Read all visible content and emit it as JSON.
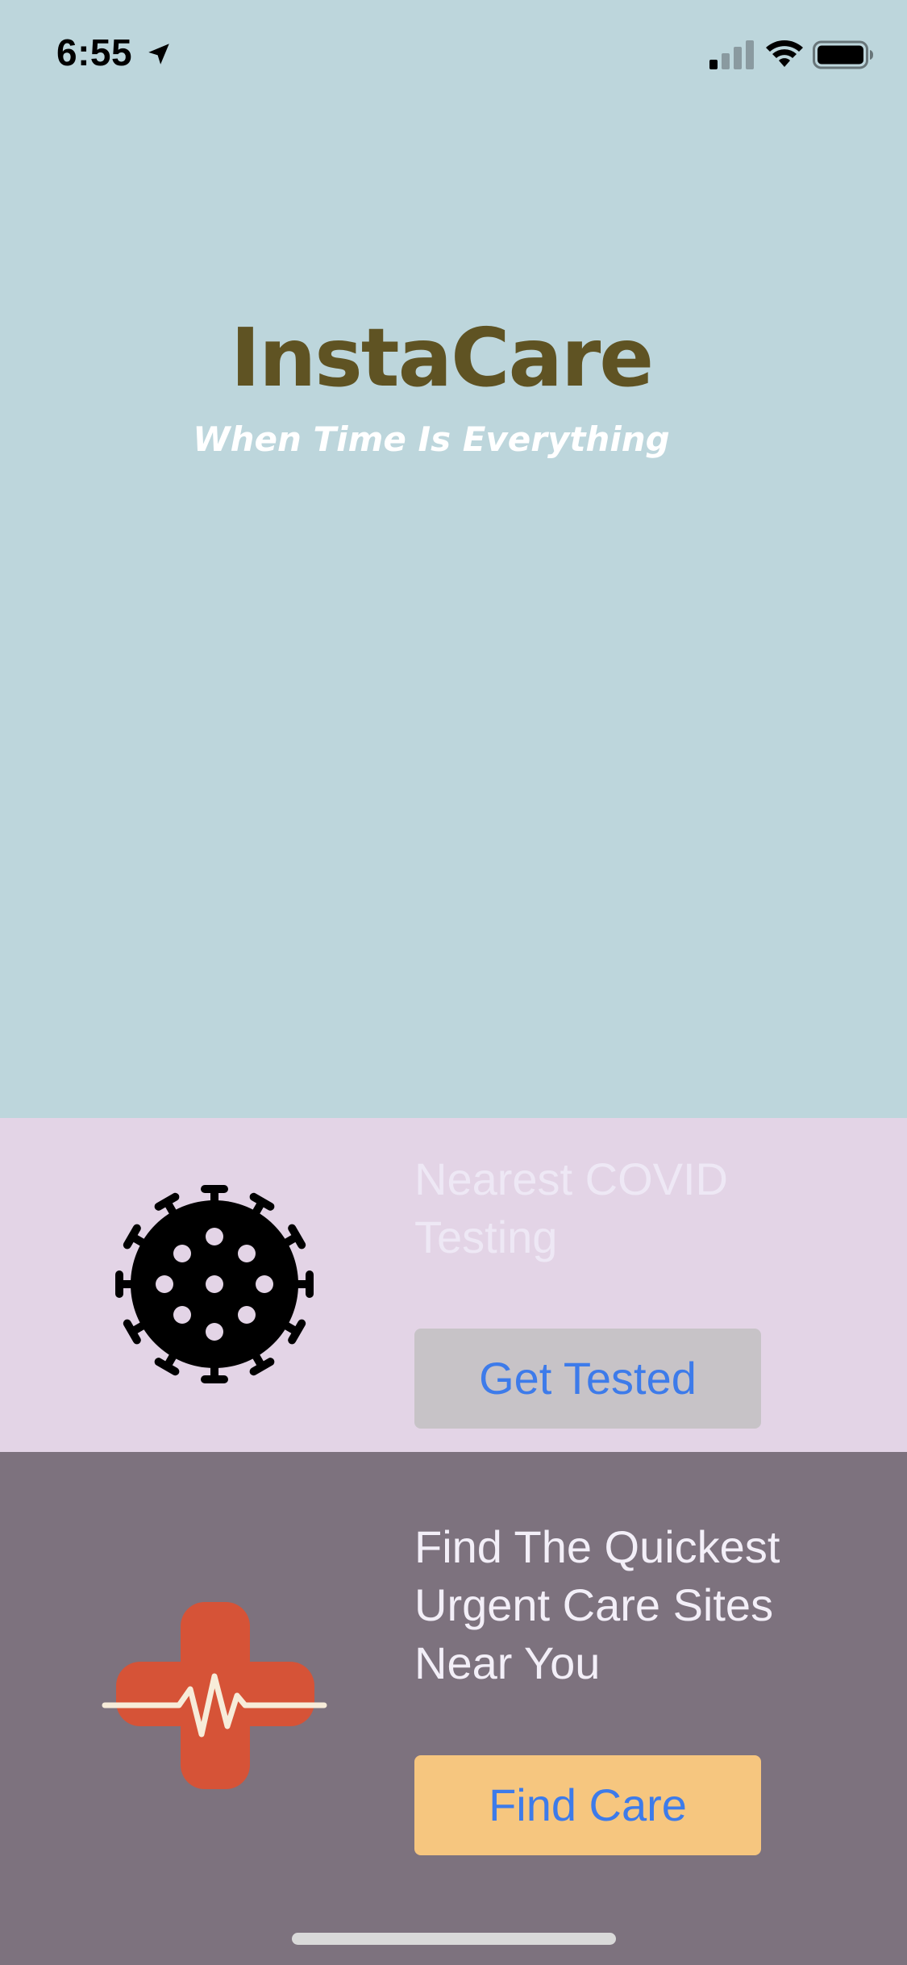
{
  "status_bar": {
    "time": "6:55"
  },
  "hero": {
    "title": "InstaCare",
    "tagline": "When Time Is Everything"
  },
  "covid": {
    "heading": "Nearest COVID Testing",
    "button_label": "Get Tested",
    "icon": "virus-icon"
  },
  "care": {
    "heading": "Find The Quickest Urgent Care Sites Near You",
    "button_label": "Find Care",
    "icon": "medical-cross-heartbeat-icon"
  },
  "colors": {
    "hero_bg": "#bdd6dc",
    "title": "#5f5323",
    "tagline": "#ffffff",
    "covid_bg": "#e3d4e6",
    "covid_heading": "#eee8f5",
    "tested_btn_bg": "#c7c3c7",
    "care_bg": "#7d727e",
    "care_heading": "#f3eff8",
    "care_btn_bg": "#f6c67f",
    "button_text": "#3d7bea",
    "cross": "#d65337",
    "virus": "#000000",
    "home_indicator": "#d9d9d9"
  }
}
